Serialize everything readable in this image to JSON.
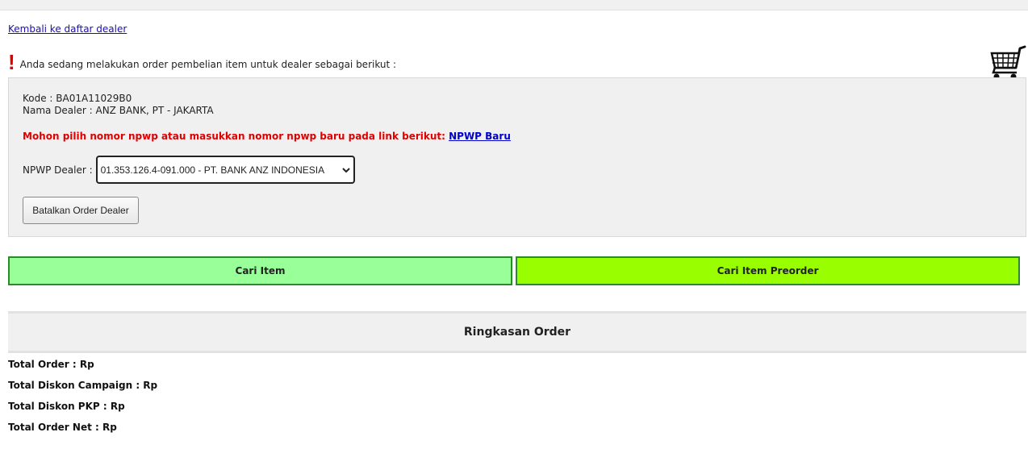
{
  "nav": {
    "back_link": "Kembali ke daftar dealer"
  },
  "notice": {
    "text": "Anda sedang melakukan order pembelian item untuk dealer sebagai berikut :"
  },
  "dealer": {
    "kode": "Kode : BA01A11029B0",
    "nama": "Nama Dealer : ANZ BANK, PT - JAKARTA",
    "warning": "Mohon pilih nomor npwp atau masukkan nomor npwp baru pada link berikut:",
    "npwp_link": "NPWP Baru",
    "npwp_label": "NPWP Dealer :",
    "npwp_selected": "01.353.126.4-091.000 - PT. BANK ANZ INDONESIA",
    "cancel_button": "Batalkan Order Dealer"
  },
  "actions": {
    "cari_item": "Cari Item",
    "cari_preorder": "Cari Item Preorder"
  },
  "summary": {
    "title": "Ringkasan Order",
    "total_order": "Total Order : Rp",
    "total_diskon_campaign": "Total Diskon Campaign : Rp",
    "total_diskon_pkp": "Total Diskon PKP : Rp",
    "total_order_net": "Total Order Net : Rp"
  },
  "colors": {
    "warning": "#e00000",
    "cari_item_bg": "#99ff99",
    "cari_preorder_bg": "#99ff00",
    "link": "#1a0dab"
  },
  "icons": {
    "alert": "exclamation-icon",
    "cart": "shopping-cart-icon",
    "select_arrow": "chevron-down-icon"
  }
}
